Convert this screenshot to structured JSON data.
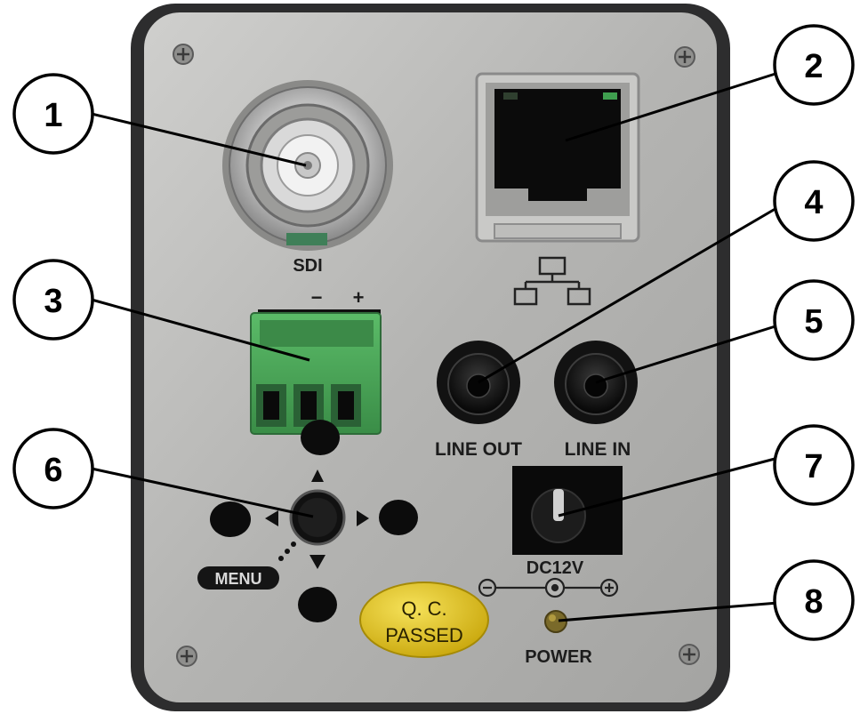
{
  "labels": {
    "sdi": "SDI",
    "minus": "−",
    "plus": "+",
    "line_out": "LINE OUT",
    "line_in": "LINE IN",
    "dc12v": "DC12V",
    "power": "POWER",
    "menu": "MENU",
    "qc_line1": "Q. C.",
    "qc_line2": "PASSED"
  },
  "callouts": [
    "1",
    "2",
    "3",
    "4",
    "5",
    "6",
    "7",
    "8"
  ],
  "colors": {
    "panel": "#b9b9b7",
    "frame": "#2d2d2e",
    "terminal_block": "#47a255",
    "qc_sticker": "#e2c21a",
    "power_led": "#7a6a2a"
  }
}
